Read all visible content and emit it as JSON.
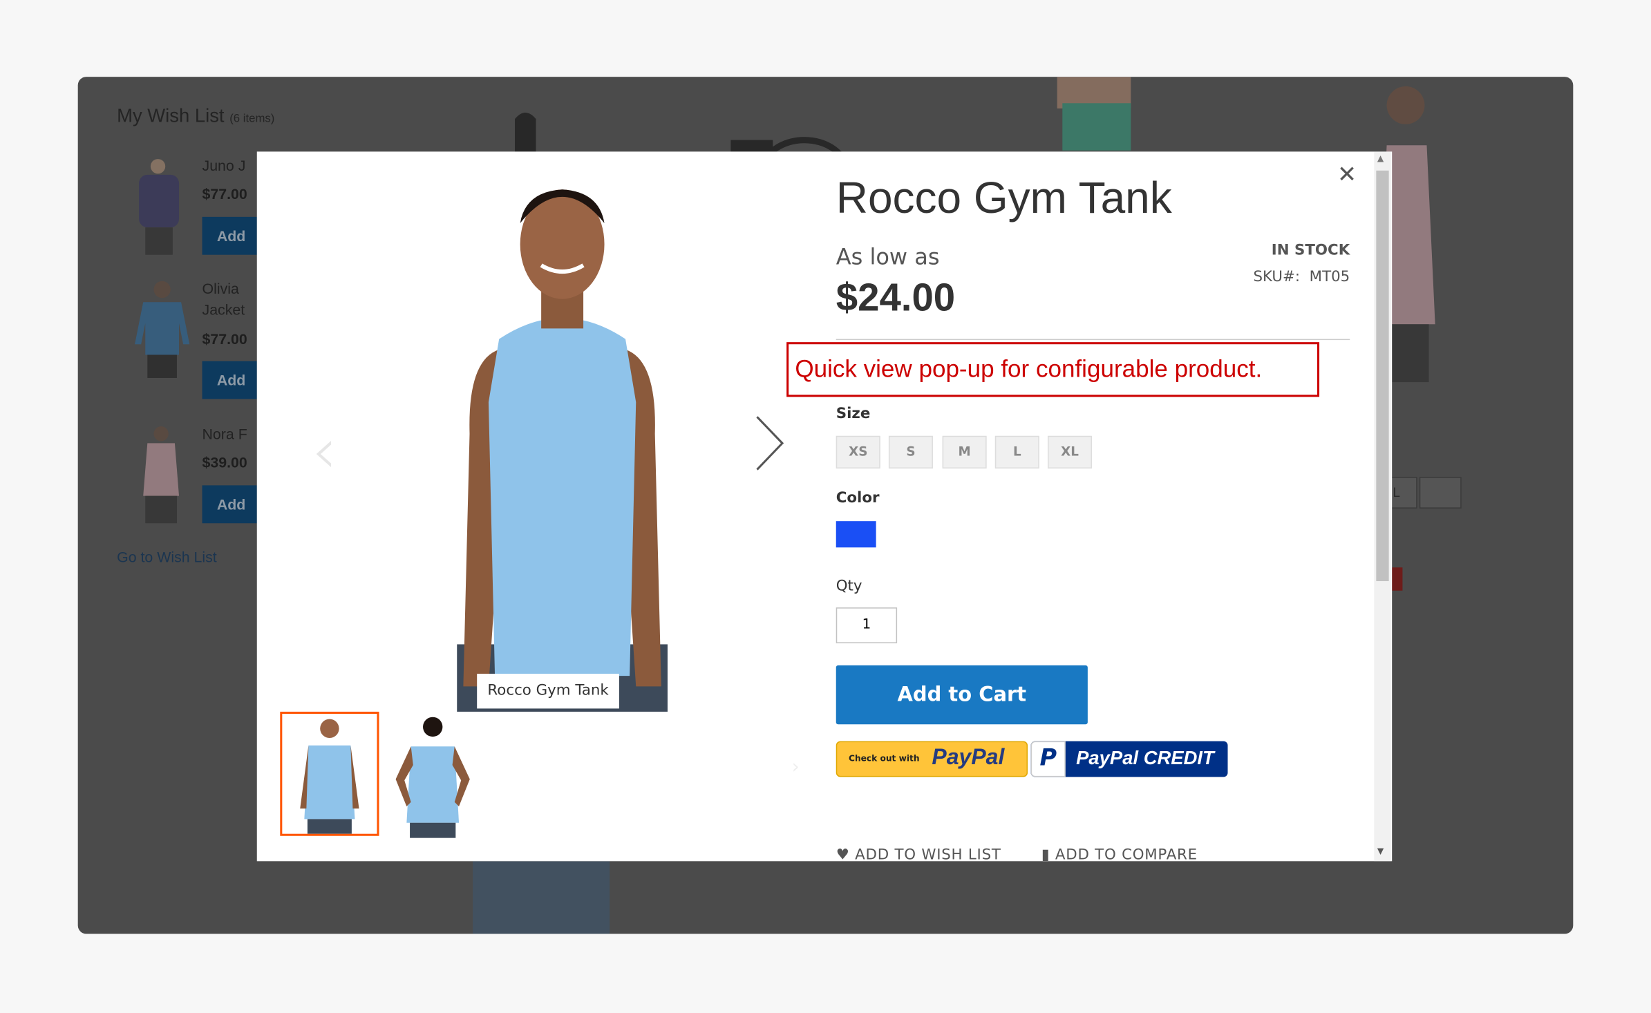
{
  "background": {
    "wishlist": {
      "title": "My Wish List",
      "count": "(6 items)",
      "items": [
        {
          "name": "Juno J",
          "price": "$77.00",
          "button": "Add",
          "color": "#2c2868"
        },
        {
          "name": "Olivia Jacket",
          "price": "$77.00",
          "button": "Add",
          "color": "#1f74b8"
        },
        {
          "name": "Nora F",
          "price": "$39.00",
          "button": "Add",
          "color": "#e9b3bd"
        }
      ],
      "go_link": "Go to Wish List"
    },
    "right_size_option": "L"
  },
  "modal": {
    "close_icon": "close-icon",
    "image_caption": "Rocco Gym Tank",
    "product_title": "Rocco Gym Tank",
    "price_prefix": "As low as",
    "price": "$24.00",
    "stock": "IN STOCK",
    "sku_label": "SKU#:",
    "sku": "MT05",
    "annotation": "Quick view pop-up for configurable product.",
    "size_label": "Size",
    "sizes": [
      "XS",
      "S",
      "M",
      "L",
      "XL"
    ],
    "color_label": "Color",
    "color_swatch": "#1a4ff5",
    "qty_label": "Qty",
    "qty_value": "1",
    "add_to_cart": "Add to Cart",
    "paypal_checkout_prefix": "Check out with",
    "paypal_brand": "PayPal",
    "paypal_credit": "PayPal CREDIT",
    "add_to_wishlist": "ADD TO WISH LIST",
    "add_to_compare": "ADD TO COMPARE",
    "colors": {
      "accent": "#1979c3",
      "annotation": "#cc0000",
      "thumb_selected": "#ff5501",
      "shirt": "#8fc3ea"
    }
  }
}
